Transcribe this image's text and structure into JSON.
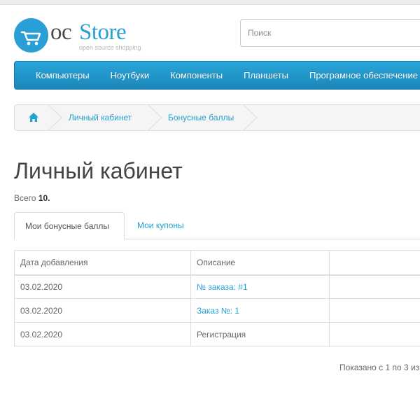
{
  "logo": {
    "part1": "oc",
    "part2": "Store",
    "tagline": "open source shopping"
  },
  "search": {
    "placeholder": "Поиск"
  },
  "menu": {
    "items": [
      "Компьютеры",
      "Ноутбуки",
      "Компоненты",
      "Планшеты",
      "Програмное обеспечение"
    ]
  },
  "breadcrumb": {
    "items": [
      "Личный кабинет",
      "Бонусные баллы"
    ]
  },
  "page": {
    "title": "Личный кабинет",
    "total_label": "Всего",
    "total_value": "10."
  },
  "tabs": {
    "active": "Мои бонусные баллы",
    "other": "Мои купоны"
  },
  "table": {
    "headers": [
      "Дата добавления",
      "Описание"
    ],
    "rows": [
      {
        "date": "03.02.2020",
        "description": "№ заказа: #1"
      },
      {
        "date": "03.02.2020",
        "description": "Заказ №: 1"
      },
      {
        "date": "03.02.2020",
        "description": "Регистрация"
      }
    ]
  },
  "pagination": {
    "text": "Показано с 1 по 3 из"
  },
  "colors": {
    "accent": "#23a1d1",
    "menu": "#229ad0",
    "logo_blue": "#2a9fd6"
  }
}
